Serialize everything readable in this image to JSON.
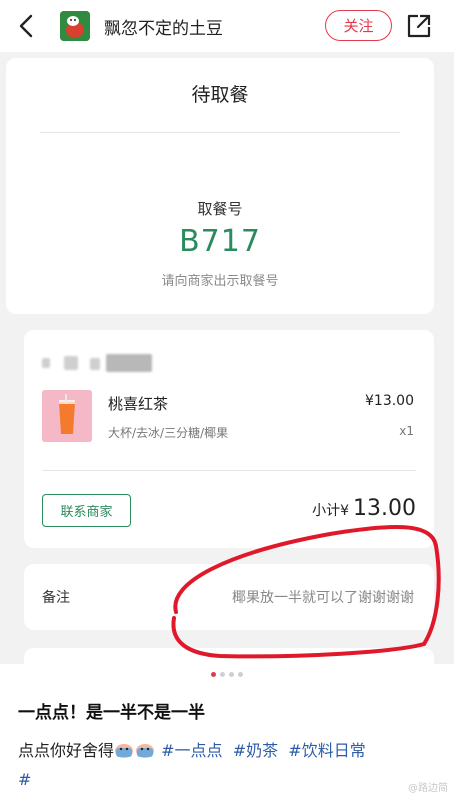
{
  "header": {
    "username": "飘忽不定的土豆",
    "follow_label": "关注"
  },
  "order": {
    "status": "待取餐",
    "pickup_label": "取餐号",
    "pickup_number": "B717",
    "pickup_hint": "请向商家出示取餐号",
    "item": {
      "name": "桃喜红茶",
      "price": "¥13.00",
      "specs": "大杯/去冰/三分糖/椰果",
      "quantity": "x1"
    },
    "contact_label": "联系商家",
    "subtotal_label": "小计¥",
    "subtotal_value": "13.00",
    "remark_label": "备注",
    "remark_text": "椰果放一半就可以了谢谢谢谢"
  },
  "pager": {
    "total": 4,
    "active": 0
  },
  "post": {
    "title": "一点点！是一半不是一半",
    "body_text": "点点你好舍得",
    "tags": [
      "#一点点",
      "#奶茶",
      "#饮料日常",
      "#"
    ]
  },
  "watermark": "@路边简",
  "colors": {
    "brand_red": "#e03a4f",
    "order_green": "#2b8a5e",
    "annotation_red": "#e0192a",
    "tag_blue": "#2f5ca8"
  }
}
